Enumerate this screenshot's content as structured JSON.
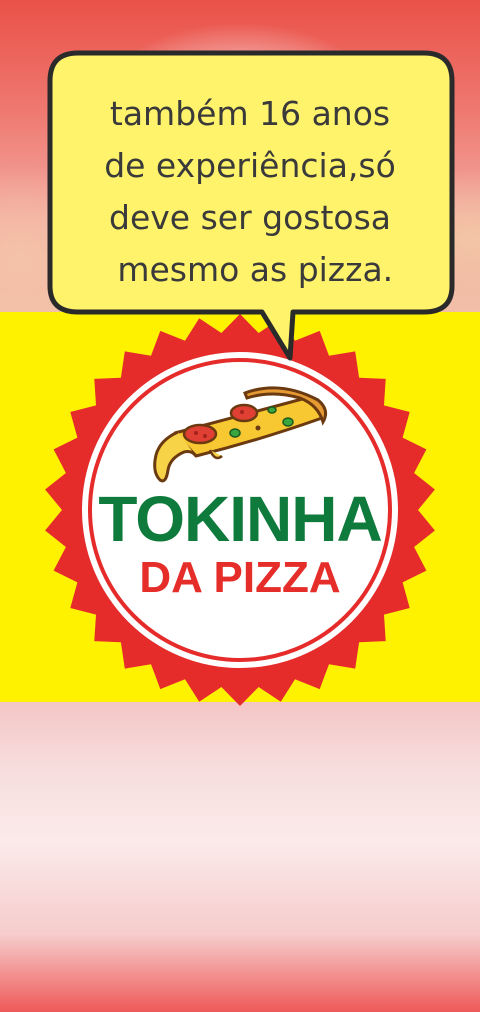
{
  "speech_bubble": {
    "lines": [
      "também 16 anos",
      "de experiência,só",
      "deve ser gostosa",
      " mesmo as pizza."
    ]
  },
  "logo": {
    "name": "TOKINHA",
    "subtitle": "DA PIZZA"
  },
  "colors": {
    "badge_red": "#e62b2b",
    "brand_green": "#0e7a3b",
    "subtitle_red": "#e52d2a",
    "panel_yellow": "#fff200",
    "bubble_yellow": "#fff36b"
  }
}
